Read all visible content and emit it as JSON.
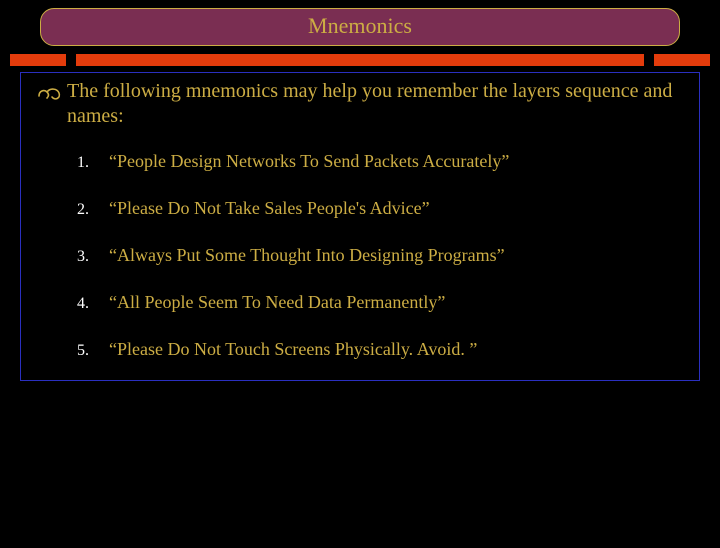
{
  "title": "Mnemonics",
  "intro": "The following mnemonics may help you remember the layers sequence and names:",
  "bullet_glyph": "§",
  "items": [
    {
      "num": "1.",
      "text": "“People Design Networks To Send Packets Accurately”"
    },
    {
      "num": "2.",
      "text": "“Please Do Not Take Sales People's Advice”"
    },
    {
      "num": "3.",
      "text": "“Always Put Some Thought Into Designing Programs”"
    },
    {
      "num": "4.",
      "text": "“All People Seem To Need Data Permanently”"
    },
    {
      "num": "5.",
      "text": "“Please Do Not Touch Screens Physically. Avoid. ”"
    }
  ]
}
